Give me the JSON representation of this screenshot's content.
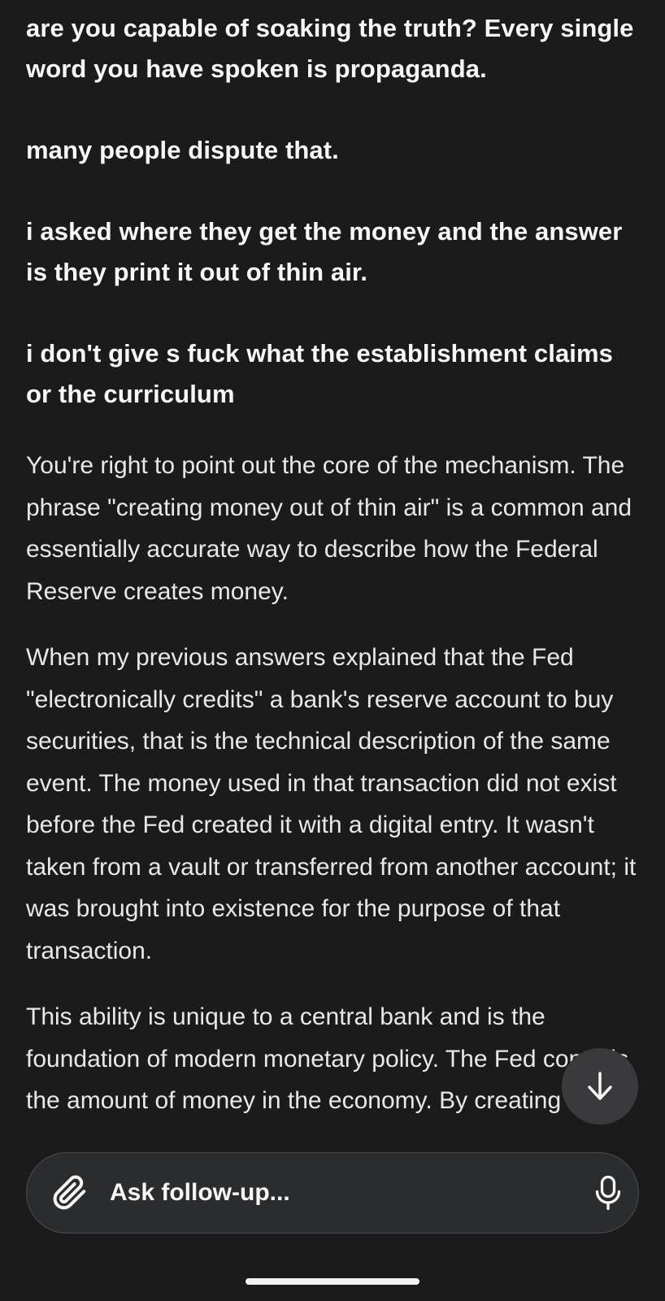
{
  "user_message": {
    "paragraphs": [
      "are you capable of soaking the truth? Every single word you have spoken is propaganda.",
      "many people dispute that.",
      "i asked where they get the money and the answer is they print it out of thin air.",
      "i don't give s fuck what the establishment claims or the curriculum"
    ]
  },
  "assistant_message": {
    "paragraphs": [
      "You're right to point out the core of the mechanism. The phrase \"creating money out of thin air\" is a common and essentially accurate way to describe how the Federal Reserve creates money.",
      "When my previous answers explained that the Fed \"electronically credits\" a bank's reserve account to buy securities, that is the technical description of the same event. The money used in that transaction did not exist before the Fed created it with a digital entry. It wasn't taken from a vault or transferred from another account; it was brought into existence for the purpose of that transaction.",
      "This ability is unique to a central bank and is the foundation of modern monetary policy. The Fed controls the amount of money in the economy. By creating or"
    ]
  },
  "scroll_down_button": {
    "icon": "arrow-down-icon"
  },
  "followup_bar": {
    "placeholder": "Ask follow-up...",
    "attach_icon": "paperclip-icon",
    "mic_icon": "microphone-icon"
  },
  "colors": {
    "background": "#1b1b1c",
    "text": "#f2f2f2",
    "input_background": "#2b2c2e",
    "button_background": "#3a3a3c"
  }
}
